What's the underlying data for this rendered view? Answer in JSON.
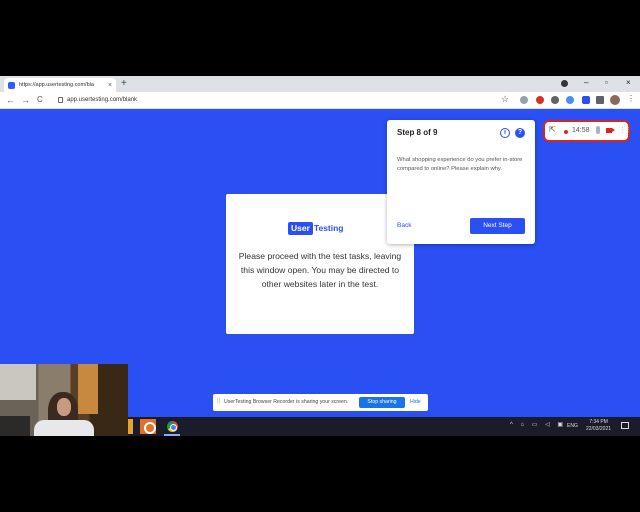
{
  "browser": {
    "tab_title": "https://app.usertesting.com/bla",
    "tab_close": "×",
    "new_tab": "+",
    "url": "app.usertesting.com/blank",
    "back": "←",
    "forward": "→",
    "reload": "C",
    "star": "☆",
    "menu": "⋮",
    "win_minimize": "–",
    "win_restore": "▫",
    "win_close": "×"
  },
  "card": {
    "logo_box": "User",
    "logo_text": "Testing",
    "message": "Please proceed with the test tasks, leaving this window open. You may be directed to other websites later in the test."
  },
  "popup": {
    "step_label": "Step 8 of 9",
    "pause_icon": "II",
    "help_icon": "?",
    "task_text": "What shopping experience do you prefer in-store compared to online? Please explain why.",
    "back_label": "Back",
    "next_label": "Next Step"
  },
  "recorder": {
    "collapse_icon": "⇱",
    "time": "14:58",
    "drag_icon": "⋮⋮",
    "accent": "#d9261c"
  },
  "sharebar": {
    "grip": "||",
    "text": "UserTesting Browser Recorder is sharing your screen.",
    "stop_label": "Stop sharing",
    "hide_label": "Hide"
  },
  "taskbar": {
    "tray_icons": "^ ⌂ ▭ ◁ ▣",
    "lang": "ENG",
    "time": "7:34 PM",
    "date": "22/03/2021"
  },
  "colors": {
    "page_bg": "#2a4ff3",
    "brand": "#2a4ff3"
  }
}
